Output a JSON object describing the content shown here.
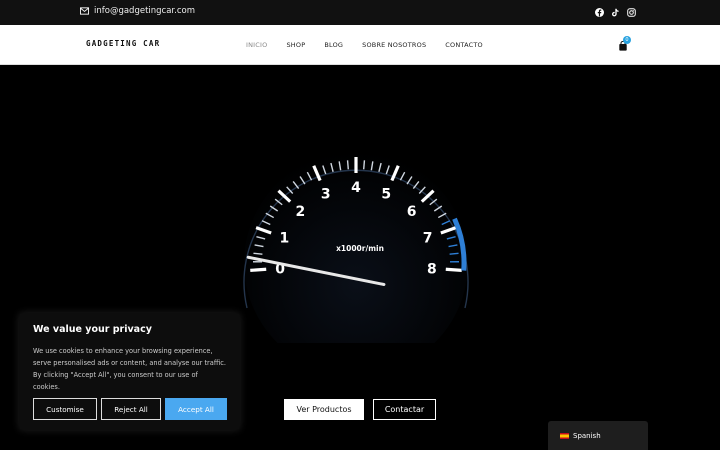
{
  "topbar": {
    "email": "info@gadgetingcar.com",
    "social_icons": [
      "facebook-icon",
      "tiktok-icon",
      "instagram-icon"
    ]
  },
  "navbar": {
    "logo": "GADGETING CAR",
    "menu": [
      {
        "label": "INICIO",
        "active": true
      },
      {
        "label": "SHOP"
      },
      {
        "label": "BLOG"
      },
      {
        "label": "SOBRE NOSOTROS"
      },
      {
        "label": "CONTACTO"
      }
    ],
    "cart_count": "0"
  },
  "hero": {
    "gauge": {
      "ticks": [
        "0",
        "1",
        "2",
        "3",
        "4",
        "5",
        "6",
        "7",
        "8"
      ],
      "unit_label": "x1000r/min",
      "needle_value": 0.3
    },
    "primary_button": "Ver Productos",
    "secondary_button": "Contactar"
  },
  "cookie": {
    "title": "We value your privacy",
    "body": "We use cookies to enhance your browsing experience, serve personalised ads or content, and analyse our traffic. By clicking \"Accept All\", you consent to our use of cookies.",
    "customise": "Customise",
    "reject": "Reject All",
    "accept": "Accept All"
  },
  "language": {
    "label": "Spanish"
  },
  "colors": {
    "accent": "#4aa8f0",
    "cart_badge": "#29a3e0",
    "redline": "#2e7fd6"
  }
}
